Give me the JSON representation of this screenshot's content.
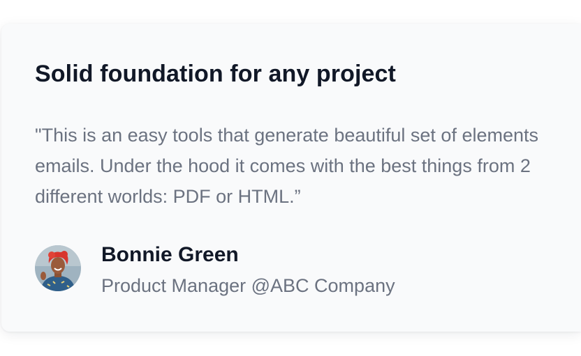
{
  "testimonial": {
    "title": "Solid foundation for any project",
    "quote": "\"This is an easy tools that generate beautiful set of elements emails. Under the hood it comes with the best things from 2 different worlds: PDF or HTML.”",
    "author": {
      "name": "Bonnie Green",
      "role": "Product Manager @ABC Company",
      "avatar_icon": "avatar-photo-icon"
    }
  },
  "colors": {
    "card_background": "#f9fafb",
    "heading": "#111827",
    "body_text": "#6b7280"
  }
}
